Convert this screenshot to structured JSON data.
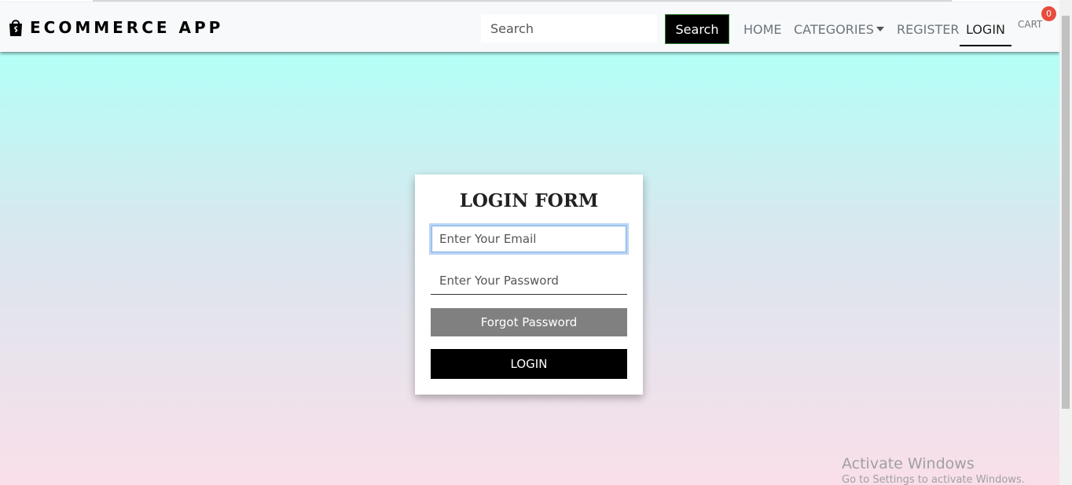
{
  "navbar": {
    "brand": "ECOMMERCE APP",
    "brand_icon": "shopping-bag-icon",
    "search_placeholder": "Search",
    "search_button": "Search",
    "links": {
      "home": "HOME",
      "categories": "CATEGORIES",
      "register": "REGISTER",
      "login": "LOGIN",
      "cart": "CART"
    },
    "cart_count": "0",
    "active_link": "login"
  },
  "login_form": {
    "title": "LOGIN FORM",
    "email_placeholder": "Enter Your Email",
    "password_placeholder": "Enter Your Password",
    "forgot_button": "Forgot Password",
    "login_button": "LOGIN"
  },
  "watermark": {
    "title": "Activate Windows",
    "subtitle": "Go to Settings to activate Windows."
  },
  "colors": {
    "background_top": "#b3fff7",
    "background_bottom": "#f9dfe9",
    "primary_button": "#000000",
    "secondary_button": "#808080",
    "badge": "#e74c3c"
  }
}
